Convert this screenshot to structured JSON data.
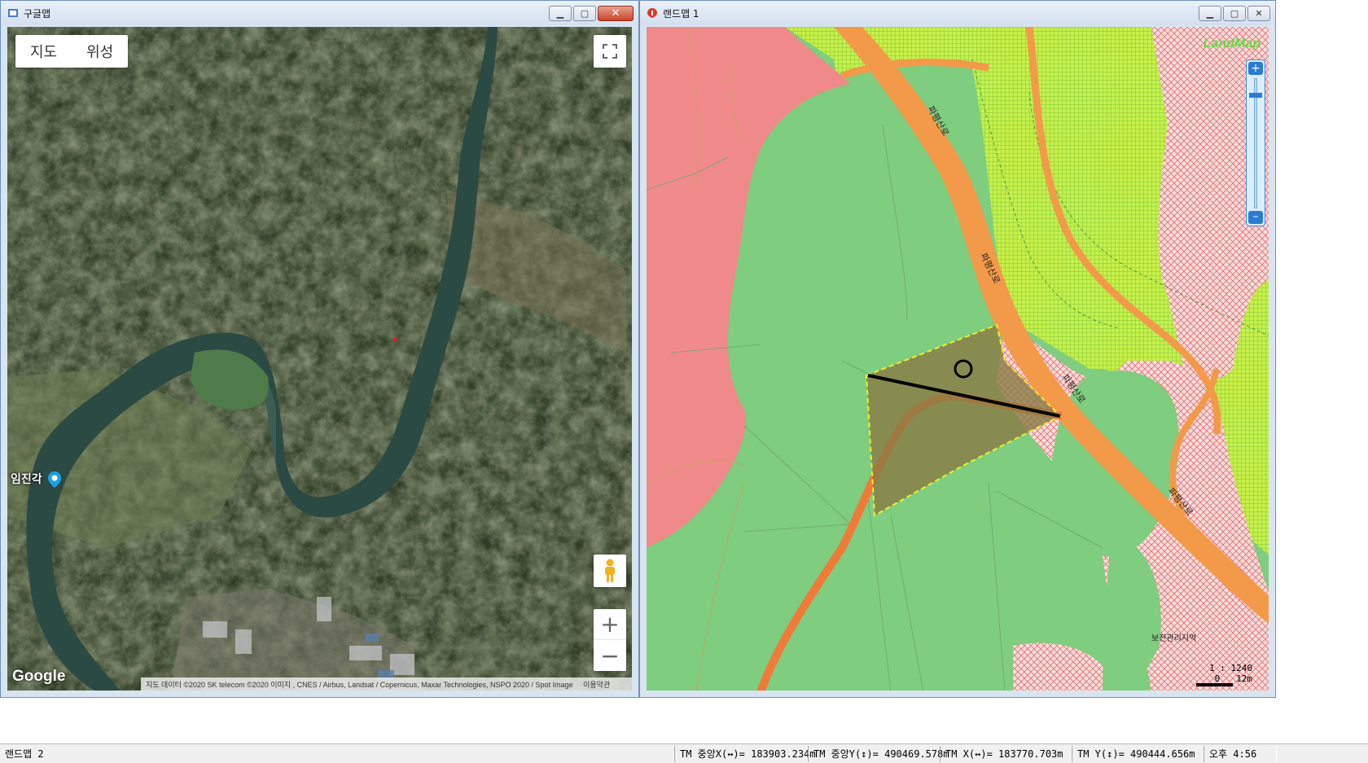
{
  "google_window": {
    "title": "구글맵",
    "map_type": {
      "map": "지도",
      "satellite": "위성"
    },
    "place_label": "임진각",
    "logo": "Google",
    "attribution": "지도 데이터 ©2020 SK telecom ©2020 이미지 , CNES / Airbus, Landsat / Copernicus, Maxar Technologies, NSPO 2020 / Spot Image",
    "terms": "이용약관",
    "zoom_in": "+",
    "zoom_out": "−"
  },
  "landmap_window": {
    "title": "랜드맵 1",
    "logo": "LandMap",
    "road_label": "파평산로",
    "zone_label": "보전관리지역",
    "scale_ratio": "1 : 1240",
    "scale_bar": "0   12m"
  },
  "status_bar": {
    "app_name": "랜드맵 2",
    "tm_center_x": "TM 중앙X(↔)= 183903.234m",
    "tm_center_y": "TM 중앙Y(↕)= 490469.578m",
    "tm_x": "TM X(↔)= 183770.703m",
    "tm_y": "TM Y(↕)= 490444.656m",
    "clock": "오후 4:56"
  },
  "colors": {
    "title_bar": "#d4e0ef",
    "landmap_green": "#7fcd7f",
    "landmap_red": "#f08a8a",
    "road_orange": "#f39a4a",
    "hatch_yellow_green": "#c8f04a",
    "selection_parcel": "#8a7a45"
  }
}
